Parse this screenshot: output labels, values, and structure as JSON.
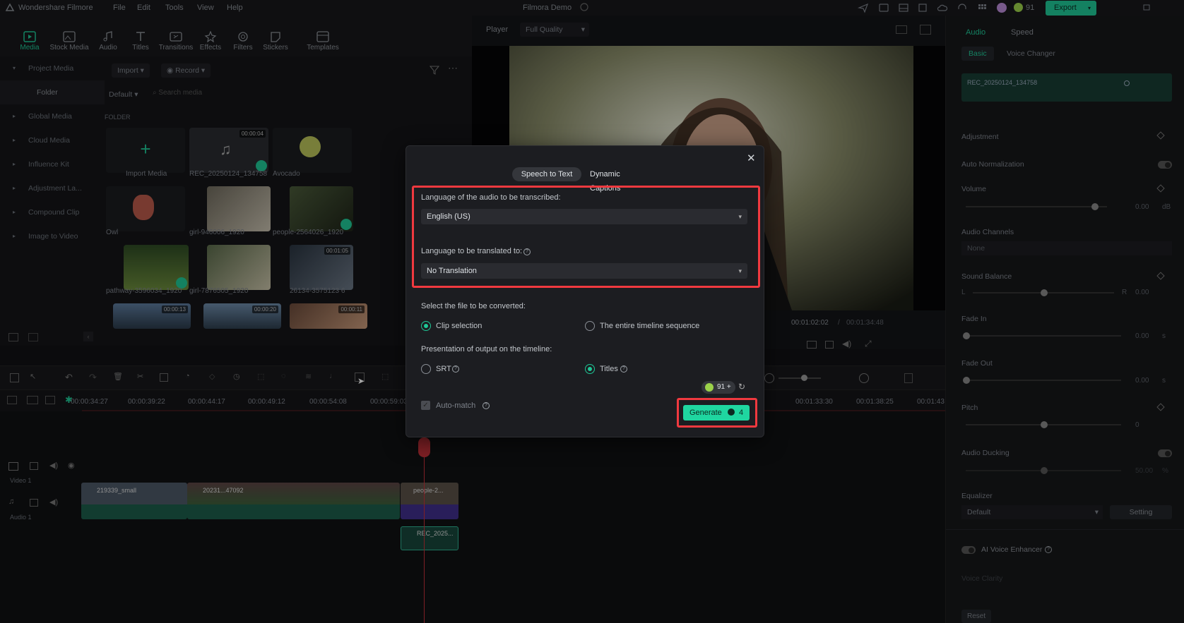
{
  "app": {
    "name": "Wondershare Filmore",
    "menu": [
      "File",
      "Edit",
      "Tools",
      "View",
      "Help"
    ],
    "project_title": "Filmora Demo",
    "credits": "91",
    "export_label": "Export"
  },
  "toolbar": {
    "tools": [
      {
        "label": "Media",
        "icon": "media-icon"
      },
      {
        "label": "Stock Media",
        "icon": "stock-media-icon"
      },
      {
        "label": "Audio",
        "icon": "audio-icon"
      },
      {
        "label": "Titles",
        "icon": "titles-icon"
      },
      {
        "label": "Transitions",
        "icon": "transitions-icon"
      },
      {
        "label": "Effects",
        "icon": "effects-icon"
      },
      {
        "label": "Filters",
        "icon": "filters-icon"
      },
      {
        "label": "Stickers",
        "icon": "stickers-icon"
      },
      {
        "label": "Templates",
        "icon": "templates-icon"
      }
    ]
  },
  "leftnav": {
    "items": [
      "Project Media",
      "Folder",
      "Global Media",
      "Cloud Media",
      "Influence Kit",
      "Adjustment La...",
      "Compound Clip",
      "Image to Video"
    ]
  },
  "media": {
    "import_label": "Import",
    "record_label": "Record",
    "sort_label": "Default",
    "search_placeholder": "Search media",
    "folder_heading": "FOLDER",
    "items": [
      {
        "label": "Import Media",
        "duration": ""
      },
      {
        "label": "REC_20250124_134758",
        "duration": "00:00:04"
      },
      {
        "label": "Avocado",
        "duration": ""
      },
      {
        "label": "Owl",
        "duration": ""
      },
      {
        "label": "girl-946006_1920",
        "duration": ""
      },
      {
        "label": "people-2564026_1920",
        "duration": ""
      },
      {
        "label": "pathway-3596034_1920",
        "duration": ""
      },
      {
        "label": "girl-7876505_1920",
        "duration": ""
      },
      {
        "label": "26134-3575123 6",
        "duration": "00:01:05"
      },
      {
        "label": "",
        "duration": "00:00:13"
      },
      {
        "label": "",
        "duration": "00:00:20"
      },
      {
        "label": "",
        "duration": "00:00:11"
      }
    ]
  },
  "player": {
    "label": "Player",
    "quality": "Full Quality",
    "current_time": "00:01:02:02",
    "total_time": "00:01:34:48"
  },
  "timeline": {
    "ruler": [
      "00:00:34:27",
      "00:00:39:22",
      "00:00:44:17",
      "00:00:49:12",
      "00:00:54:08",
      "00:00:59:03",
      "00:01:33:30",
      "00:01:38:25",
      "00:01:43"
    ],
    "video_track_label": "Video 1",
    "audio_track_label": "Audio 1",
    "clip_labels": [
      "219339_small",
      "20231...47092",
      "people-2...",
      "REC_2025..."
    ]
  },
  "right_panel": {
    "tabs": [
      "Audio",
      "Speed"
    ],
    "subtabs": [
      "Basic",
      "Voice Changer"
    ],
    "clip_name": "REC_20250124_134758",
    "adjustment": "Adjustment",
    "auto_normalization": "Auto Normalization",
    "volume": {
      "label": "Volume",
      "value": "0.00",
      "unit": "dB"
    },
    "audio_channels": {
      "label": "Audio Channels",
      "value": "None"
    },
    "sound_balance": {
      "label": "Sound Balance",
      "left": "L",
      "right": "R",
      "value": "0.00"
    },
    "fade_in": {
      "label": "Fade In",
      "value": "0.00",
      "unit": "s"
    },
    "fade_out": {
      "label": "Fade Out",
      "value": "0.00",
      "unit": "s"
    },
    "pitch": {
      "label": "Pitch",
      "value": "0"
    },
    "audio_ducking": {
      "label": "Audio Ducking",
      "value": "50.00",
      "unit": "%"
    },
    "equalizer": {
      "label": "Equalizer",
      "value": "Default",
      "setting": "Setting"
    },
    "ai_voice_enhancer": "AI Voice Enhancer",
    "voice_clarity": "Voice Clarity",
    "reset": "Reset"
  },
  "dialog": {
    "tabs": [
      "Speech to Text",
      "Dynamic Captions"
    ],
    "source_lang_label": "Language of the audio to be transcribed:",
    "source_lang_value": "English (US)",
    "target_lang_label": "Language to be translated to:",
    "target_lang_value": "No Translation",
    "file_label": "Select the file to be converted:",
    "file_options": [
      "Clip selection",
      "The entire timeline sequence"
    ],
    "output_label": "Presentation of output on the timeline:",
    "output_options": [
      "SRT",
      "Titles"
    ],
    "credits": "91",
    "auto_match": "Auto-match",
    "generate_label": "Generate",
    "generate_cost": "4"
  },
  "colors": {
    "accent": "#1fc796",
    "highlight": "#f0393f"
  }
}
